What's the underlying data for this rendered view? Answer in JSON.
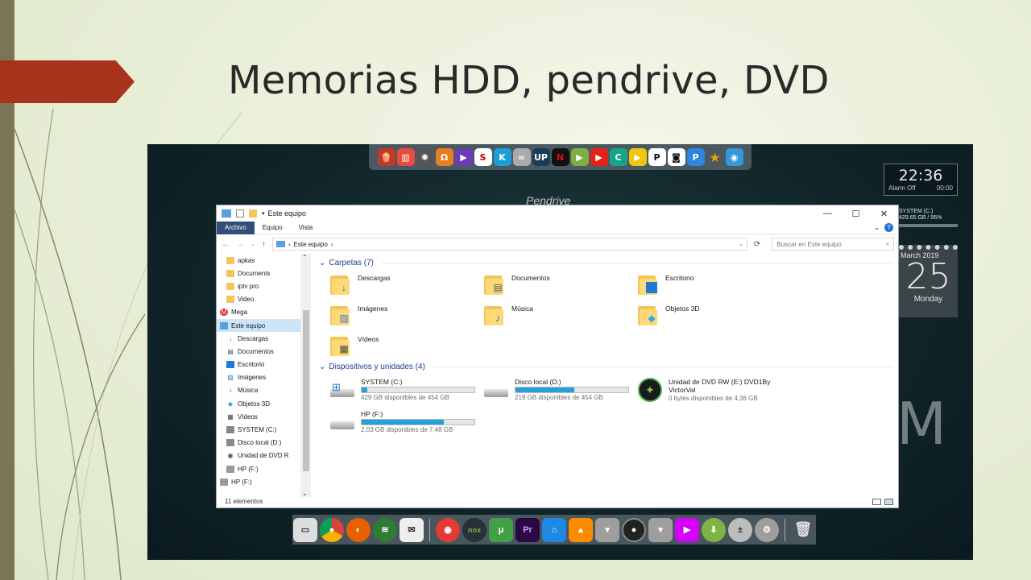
{
  "slide": {
    "title": "Memorias HDD, pendrive, DVD",
    "accent_color": "#a8321a"
  },
  "desktop": {
    "bg_text": "Pendrive",
    "clock": {
      "time": "22:36",
      "alarm": "Alarm Off",
      "alarm_time": "00:00"
    },
    "system_widget": {
      "drive": "SYSTEM (C:)",
      "usage": "429.65 GB / 95%"
    },
    "calendar": {
      "month": "March 2019",
      "day": "25",
      "weekday": "Monday"
    },
    "big_letter": "M",
    "top_dock_icons": [
      "popcorn-icon",
      "popcorn-bucket-icon",
      "film-reel-icon",
      "headphones-icon",
      "prime-icon",
      "sly-icon",
      "kodi-icon",
      "app-icon",
      "up-icon",
      "netflix-icon",
      "play-icon",
      "youtube-icon",
      "c-icon",
      "play-circle-icon",
      "plex-icon",
      "movie-camera-icon",
      "p-icon",
      "star-icon",
      "media-icon"
    ],
    "bottom_dock_icons": [
      "finder-icon",
      "chrome-icon",
      "firefox-icon",
      "wifi-icon",
      "stamp-icon",
      "rss-icon",
      "nox-icon",
      "utorrent-icon",
      "premiere-icon",
      "controller-icon",
      "vlc-icon",
      "gray-icon",
      "record-icon",
      "gray2-icon",
      "player-icon",
      "download-icon",
      "calculator-icon",
      "settings-icon",
      "trash-icon"
    ]
  },
  "explorer": {
    "title": "Este equipo",
    "ribbon_tabs": [
      "Archivo",
      "Equipo",
      "Vista"
    ],
    "address": "Este equipo",
    "search_placeholder": "Buscar en Este equipo",
    "nav_items": [
      {
        "label": "apkas",
        "level": 1,
        "icon": "folder-icon"
      },
      {
        "label": "Documents",
        "level": 1,
        "icon": "folder-icon"
      },
      {
        "label": "iptv pro",
        "level": 1,
        "icon": "folder-icon"
      },
      {
        "label": "Video",
        "level": 1,
        "icon": "folder-icon"
      },
      {
        "label": "Mega",
        "level": 0,
        "icon": "mega-icon"
      },
      {
        "label": "Este equipo",
        "level": 0,
        "icon": "computer-icon",
        "selected": true
      },
      {
        "label": "Descargas",
        "level": 1,
        "icon": "download-arrow-icon"
      },
      {
        "label": "Documentos",
        "level": 1,
        "icon": "document-icon"
      },
      {
        "label": "Escritorio",
        "level": 1,
        "icon": "desktop-icon"
      },
      {
        "label": "Imágenes",
        "level": 1,
        "icon": "image-icon"
      },
      {
        "label": "Música",
        "level": 1,
        "icon": "music-icon"
      },
      {
        "label": "Objetos 3D",
        "level": 1,
        "icon": "cube-icon"
      },
      {
        "label": "Vídeos",
        "level": 1,
        "icon": "video-icon"
      },
      {
        "label": "SYSTEM (C:)",
        "level": 1,
        "icon": "drive-icon"
      },
      {
        "label": "Disco local (D:)",
        "level": 1,
        "icon": "drive-icon"
      },
      {
        "label": "Unidad de DVD R",
        "level": 1,
        "icon": "dvd-icon"
      },
      {
        "label": "HP (F:)",
        "level": 1,
        "icon": "usb-drive-icon"
      },
      {
        "label": "HP (F:)",
        "level": 0,
        "icon": "usb-drive-icon"
      }
    ],
    "folders_header": "Carpetas (7)",
    "folders": [
      {
        "label": "Descargas",
        "badge": "download-arrow-icon"
      },
      {
        "label": "Documentos",
        "badge": "document-icon"
      },
      {
        "label": "Escritorio",
        "badge": "desktop-icon"
      },
      {
        "label": "Imágenes",
        "badge": "image-icon"
      },
      {
        "label": "Música",
        "badge": "music-icon"
      },
      {
        "label": "Objetos 3D",
        "badge": "cube-icon"
      },
      {
        "label": "Vídeos",
        "badge": "video-icon"
      }
    ],
    "devices_header": "Dispositivos y unidades (4)",
    "drives": [
      {
        "name": "SYSTEM (C:)",
        "free": "429 GB disponibles de 454 GB",
        "used_fraction": 0.05,
        "icon": "windows-drive-icon"
      },
      {
        "name": "Disco local (D:)",
        "free": "219 GB disponibles de 454 GB",
        "used_fraction": 0.52,
        "icon": "drive-icon"
      },
      {
        "name": "Unidad de DVD RW (E:) DVD1By VictorVal",
        "free": "0 bytes disponibles de 4,36 GB",
        "used_fraction": null,
        "icon": "dvd-icon"
      },
      {
        "name": "HP (F:)",
        "free": "2,03 GB disponibles de 7,48 GB",
        "used_fraction": 0.73,
        "icon": "usb-drive-icon"
      }
    ],
    "status": "11 elementos"
  }
}
